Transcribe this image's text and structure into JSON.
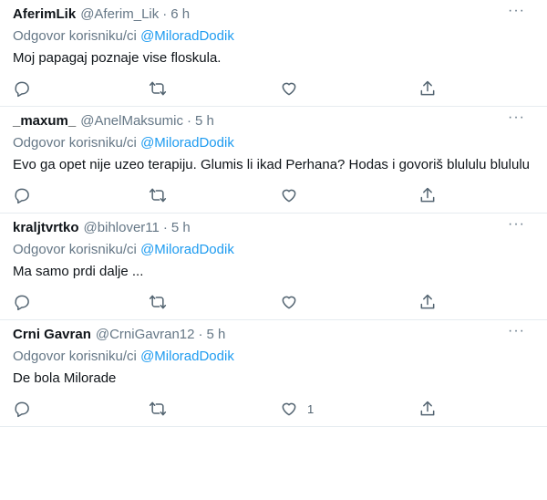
{
  "tweets": [
    {
      "display_name": "AferimLik",
      "handle": "@Aferim_Lik",
      "time": "6 h",
      "reply_prefix": "Odgovor korisniku/ci",
      "reply_to": "@MiloradDodik",
      "text": "Moj papagaj poznaje vise floskula.",
      "like_count": ""
    },
    {
      "display_name": "_maxum_",
      "handle": "@AnelMaksumic",
      "time": "5 h",
      "reply_prefix": "Odgovor korisniku/ci",
      "reply_to": "@MiloradDodik",
      "text": "Evo ga opet nije uzeo terapiju. Glumis li ikad Perhana? Hodas i govoriš blululu blululu",
      "like_count": ""
    },
    {
      "display_name": "kraljtvrtko",
      "handle": "@bihlover11",
      "time": "5 h",
      "reply_prefix": "Odgovor korisniku/ci",
      "reply_to": "@MiloradDodik",
      "text": "Ma samo prdi dalje ...",
      "like_count": ""
    },
    {
      "display_name": "Crni Gavran",
      "handle": "@CrniGavran12",
      "time": "5 h",
      "reply_prefix": "Odgovor korisniku/ci",
      "reply_to": "@MiloradDodik",
      "text": "De bola Milorade",
      "like_count": "1"
    }
  ],
  "dot": "·",
  "more": "···",
  "icons": {
    "reply": "reply-icon",
    "retweet": "retweet-icon",
    "like": "like-icon",
    "share": "share-icon",
    "more": "more-icon"
  },
  "colors": {
    "mention": "#1d9bf0",
    "muted": "#657786",
    "text": "#0f1419",
    "divider": "#e6ecf0"
  }
}
